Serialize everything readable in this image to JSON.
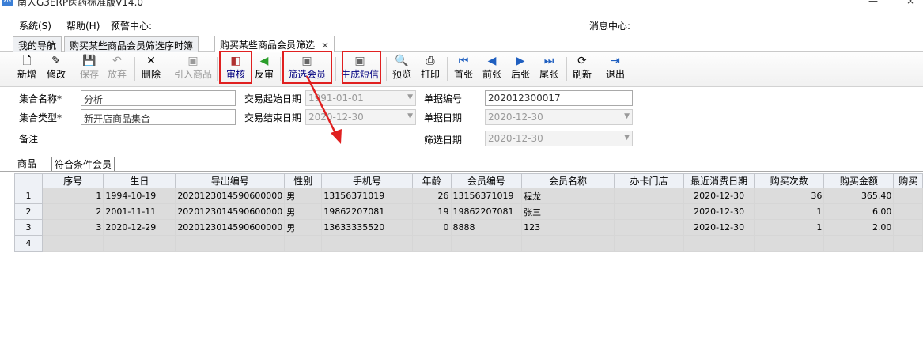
{
  "window": {
    "title": "南人G3ERP医药标准版V14.0",
    "app_icon_text": "XG",
    "minimize": "—",
    "close": "×"
  },
  "menu": {
    "items": [
      "系统(S)",
      "帮助(H)",
      "预警中心:"
    ],
    "message_center": "消息中心:"
  },
  "tabs": [
    {
      "label": "我的导航"
    },
    {
      "label": "购买某些商品会员筛选序时簿"
    },
    {
      "label": "购买某些商品会员筛选",
      "close": "×"
    }
  ],
  "toolbar": {
    "buttons": [
      {
        "label": "新增",
        "icon": "new-doc-icon",
        "glyph": "🗋"
      },
      {
        "label": "修改",
        "icon": "edit-icon",
        "glyph": "✎"
      },
      {
        "label": "保存",
        "icon": "save-icon",
        "glyph": "💾"
      },
      {
        "label": "放弃",
        "icon": "undo-icon",
        "glyph": "↶"
      },
      {
        "label": "删除",
        "icon": "delete-icon",
        "glyph": "✕"
      },
      {
        "label": "引入商品",
        "icon": "import-icon",
        "glyph": "▣"
      },
      {
        "label": "审核",
        "icon": "audit-icon",
        "glyph": "◧"
      },
      {
        "label": "反审",
        "icon": "unaudit-icon",
        "glyph": "◀"
      },
      {
        "label": "筛选会员",
        "icon": "filter-member-icon",
        "glyph": "▣"
      },
      {
        "label": "生成短信",
        "icon": "sms-icon",
        "glyph": "▣"
      },
      {
        "label": "预览",
        "icon": "preview-icon",
        "glyph": "🔍"
      },
      {
        "label": "打印",
        "icon": "print-icon",
        "glyph": "⎙"
      },
      {
        "label": "首张",
        "icon": "first-icon",
        "glyph": "⏮"
      },
      {
        "label": "前张",
        "icon": "prev-icon",
        "glyph": "◀"
      },
      {
        "label": "后张",
        "icon": "next-icon",
        "glyph": "▶"
      },
      {
        "label": "尾张",
        "icon": "last-icon",
        "glyph": "⏭"
      },
      {
        "label": "刷新",
        "icon": "refresh-icon",
        "glyph": "⟳"
      },
      {
        "label": "退出",
        "icon": "exit-icon",
        "glyph": "⇥"
      }
    ],
    "accent": "#e02020"
  },
  "form": {
    "set_name_label": "集合名称*",
    "set_name_value": "分析",
    "set_type_label": "集合类型*",
    "set_type_value": "新开店商品集合",
    "remark_label": "备注",
    "remark_value": "",
    "trade_start_label": "交易起始日期",
    "trade_start_value": "1991-01-01",
    "trade_end_label": "交易结束日期",
    "trade_end_value": "2020-12-30",
    "doc_no_label": "单据编号",
    "doc_no_value": "202012300017",
    "doc_date_label": "单据日期",
    "doc_date_value": "2020-12-30",
    "filter_date_label": "筛选日期",
    "filter_date_value": "2020-12-30",
    "dropdown_arrow": "▼"
  },
  "subtabs": [
    "商品",
    "符合条件会员"
  ],
  "grid": {
    "columns": [
      "",
      "序号",
      "生日",
      "导出编号",
      "性别",
      "手机号",
      "年龄",
      "会员编号",
      "会员名称",
      "办卡门店",
      "最近消费日期",
      "购买次数",
      "购买金额",
      "购买"
    ],
    "rows": [
      [
        "1",
        "1",
        "1994-10-19",
        "2020123014590600000",
        "男",
        "13156371019",
        "26",
        "13156371019",
        "程龙",
        "",
        "2020-12-30",
        "36",
        "365.40",
        ""
      ],
      [
        "2",
        "2",
        "2001-11-11",
        "2020123014590600000",
        "男",
        "19862207081",
        "19",
        "19862207081",
        "张三",
        "",
        "2020-12-30",
        "1",
        "6.00",
        ""
      ],
      [
        "3",
        "3",
        "2020-12-29",
        "2020123014590600000",
        "男",
        "13633335520",
        "0",
        "8888",
        "123",
        "",
        "2020-12-30",
        "1",
        "2.00",
        ""
      ],
      [
        "4",
        "",
        "",
        "",
        "",
        "",
        "",
        "",
        "",
        "",
        "",
        "",
        "",
        ""
      ]
    ]
  }
}
